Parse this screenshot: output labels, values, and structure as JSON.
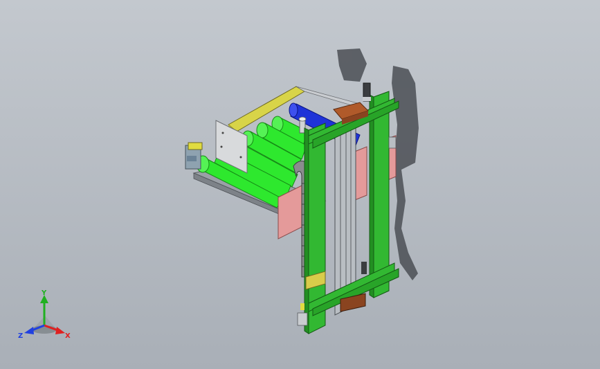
{
  "viewport": {
    "background_top": "#c3c8ce",
    "background_bottom": "#a9afb7"
  },
  "model": {
    "frame_color": "#32b832",
    "roller_color": "#2ee82e",
    "blue_roller_color": "#1a2fd6",
    "plate_color": "#e49a9a",
    "rail_color": "#d6d24a",
    "shadow_color": "#4a4a4a"
  },
  "triad": {
    "x_label": "X",
    "y_label": "Y",
    "z_label": "Z",
    "x_color": "#e02020",
    "y_color": "#20b020",
    "z_color": "#2040e0"
  }
}
